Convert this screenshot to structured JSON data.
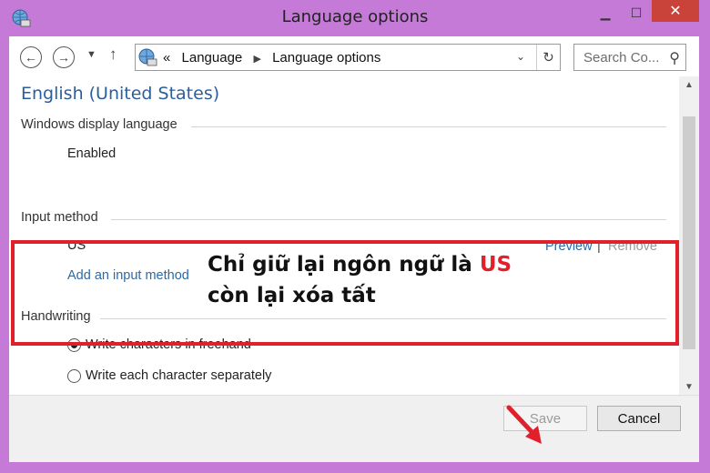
{
  "window": {
    "title": "Language options"
  },
  "nav": {
    "back_icon": "back-arrow-icon",
    "forward_icon": "forward-arrow-icon",
    "up_icon": "up-arrow-icon",
    "breadcrumb_prefix": "«",
    "breadcrumbs": [
      "Language",
      "Language options"
    ],
    "search_placeholder": "Search Co..."
  },
  "content": {
    "language_name": "English (United States)",
    "display_language": {
      "heading": "Windows display language",
      "status": "Enabled"
    },
    "input_method": {
      "heading": "Input method",
      "method": "US",
      "preview_label": "Preview",
      "separator": "|",
      "remove_label": "Remove",
      "add_label": "Add an input method"
    },
    "handwriting": {
      "heading": "Handwriting",
      "options": [
        {
          "label": "Write characters in freehand",
          "selected": true
        },
        {
          "label": "Write each character separately",
          "selected": false
        }
      ]
    }
  },
  "annotation": {
    "line1_prefix": "Chỉ giữ lại ngôn ngữ là ",
    "line1_highlight": "US",
    "line2": "còn lại xóa tất",
    "highlight_color": "#e0202a"
  },
  "footer": {
    "save_label": "Save",
    "cancel_label": "Cancel"
  },
  "colors": {
    "frame": "#c47ad6",
    "link": "#2a6aa8",
    "title_blue": "#2a5f9e",
    "close_button": "#c9433b"
  }
}
